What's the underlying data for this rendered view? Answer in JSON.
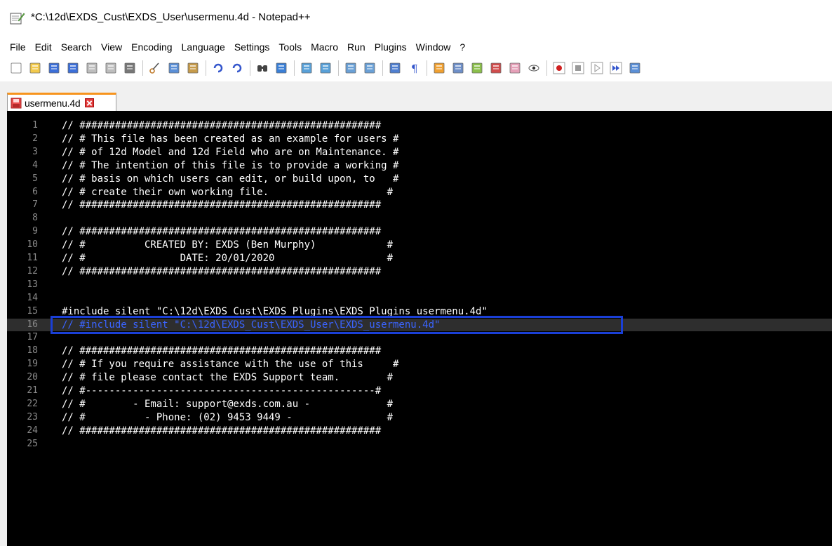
{
  "window": {
    "title": "*C:\\12d\\EXDS_Cust\\EXDS_User\\usermenu.4d - Notepad++"
  },
  "menu": [
    "File",
    "Edit",
    "Search",
    "View",
    "Encoding",
    "Language",
    "Settings",
    "Tools",
    "Macro",
    "Run",
    "Plugins",
    "Window",
    "?"
  ],
  "toolbar": {
    "icons": [
      "new-file-icon",
      "open-file-icon",
      "save-icon",
      "save-all-icon",
      "close-icon",
      "close-all-icon",
      "print-icon",
      "cut-icon",
      "copy-icon",
      "paste-icon",
      "undo-icon",
      "redo-icon",
      "find-icon",
      "replace-icon",
      "zoom-in-icon",
      "zoom-out-icon",
      "sync-vertical-icon",
      "sync-horizontal-icon",
      "word-wrap-icon",
      "show-all-chars-icon",
      "indent-guide-icon",
      "user-lang-icon",
      "doc-map-icon",
      "function-list-icon",
      "folder-workspace-icon",
      "monitor-icon",
      "record-macro-icon",
      "stop-record-icon",
      "play-macro-icon",
      "run-macro-multiple-icon",
      "save-macro-icon"
    ]
  },
  "tab": {
    "label": "usermenu.4d"
  },
  "editor": {
    "lines": [
      {
        "n": "1",
        "text": "// ###################################################"
      },
      {
        "n": "2",
        "text": "// # This file has been created as an example for users #"
      },
      {
        "n": "3",
        "text": "// # of 12d Model and 12d Field who are on Maintenance. #"
      },
      {
        "n": "4",
        "text": "// # The intention of this file is to provide a working #"
      },
      {
        "n": "5",
        "text": "// # basis on which users can edit, or build upon, to   #"
      },
      {
        "n": "6",
        "text": "// # create their own working file.                    #"
      },
      {
        "n": "7",
        "text": "// ###################################################"
      },
      {
        "n": "8",
        "text": ""
      },
      {
        "n": "9",
        "text": "// ###################################################"
      },
      {
        "n": "10",
        "text": "// #          CREATED BY: EXDS (Ben Murphy)            #"
      },
      {
        "n": "11",
        "text": "// #                DATE: 20/01/2020                   #"
      },
      {
        "n": "12",
        "text": "// ###################################################"
      },
      {
        "n": "13",
        "text": ""
      },
      {
        "n": "14",
        "text": ""
      },
      {
        "n": "15",
        "text": "#include silent \"C:\\12d\\EXDS_Cust\\EXDS_Plugins\\EXDS_Plugins_usermenu.4d\""
      },
      {
        "n": "16",
        "text": "// #include silent \"C:\\12d\\EXDS_Cust\\EXDS_User\\EXDS_usermenu.4d\""
      },
      {
        "n": "17",
        "text": ""
      },
      {
        "n": "18",
        "text": "// ###################################################"
      },
      {
        "n": "19",
        "text": "// # If you require assistance with the use of this     #"
      },
      {
        "n": "20",
        "text": "// # file please contact the EXDS Support team.        #"
      },
      {
        "n": "21",
        "text": "// #-------------------------------------------------#"
      },
      {
        "n": "22",
        "text": "// #        - Email: support@exds.com.au -             #"
      },
      {
        "n": "23",
        "text": "// #          - Phone: (02) 9453 9449 -                #"
      },
      {
        "n": "24",
        "text": "// ###################################################"
      },
      {
        "n": "25",
        "text": ""
      }
    ]
  },
  "colors": {
    "editor_bg": "#000000",
    "line_number": "#8a8a8a",
    "highlight_box": "#1a3fd6",
    "selected_text": "#3a64ff",
    "tab_accent": "#f7941d"
  }
}
